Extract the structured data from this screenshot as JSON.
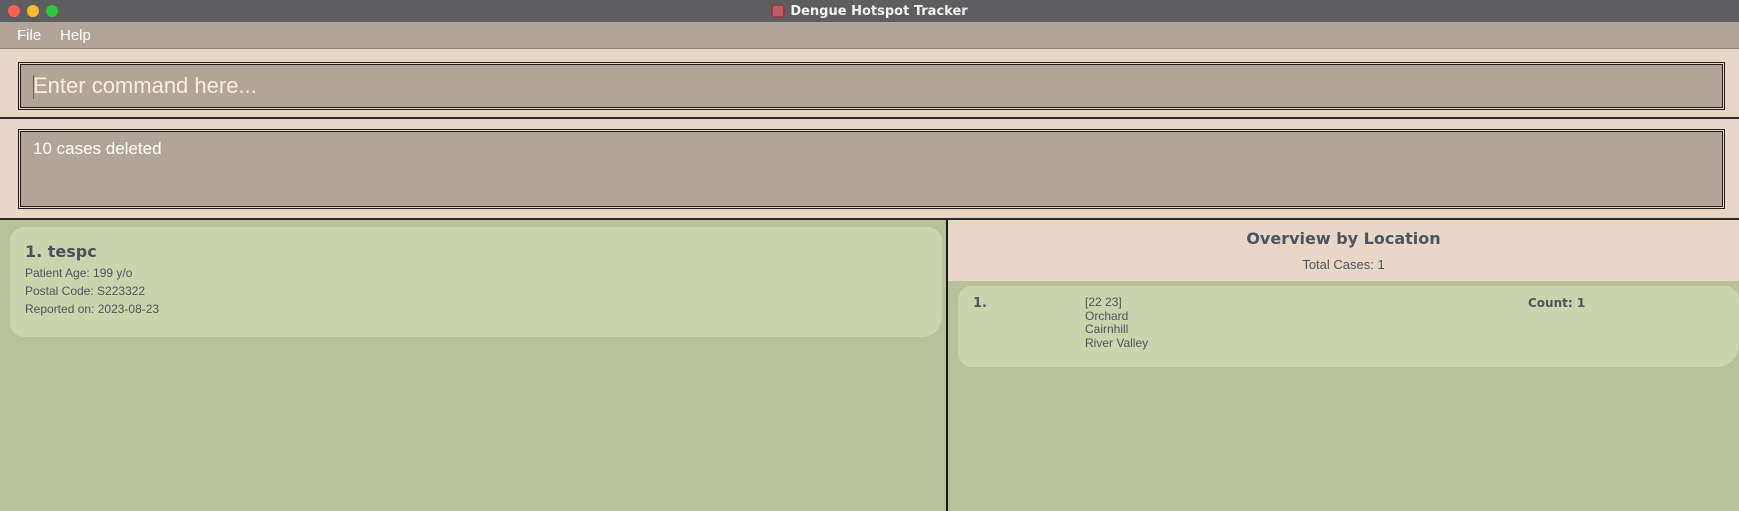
{
  "window": {
    "title": "Dengue Hotspot Tracker"
  },
  "menu": {
    "items": [
      "File",
      "Help"
    ]
  },
  "command": {
    "placeholder": "Enter command here...",
    "value": ""
  },
  "result": {
    "message": "10 cases deleted"
  },
  "cases": [
    {
      "title": "1. tespc",
      "age": "Patient Age: 199 y/o",
      "postal": "Postal Code: S223322",
      "reported": "Reported on: 2023-08-23"
    }
  ],
  "overview": {
    "title": "Overview by Location",
    "total": "Total Cases: 1",
    "items": [
      {
        "index": "1.",
        "lines": [
          "[22 23]",
          "Orchard",
          "Cairnhill",
          "River Valley"
        ],
        "count": "Count: 1"
      }
    ]
  }
}
